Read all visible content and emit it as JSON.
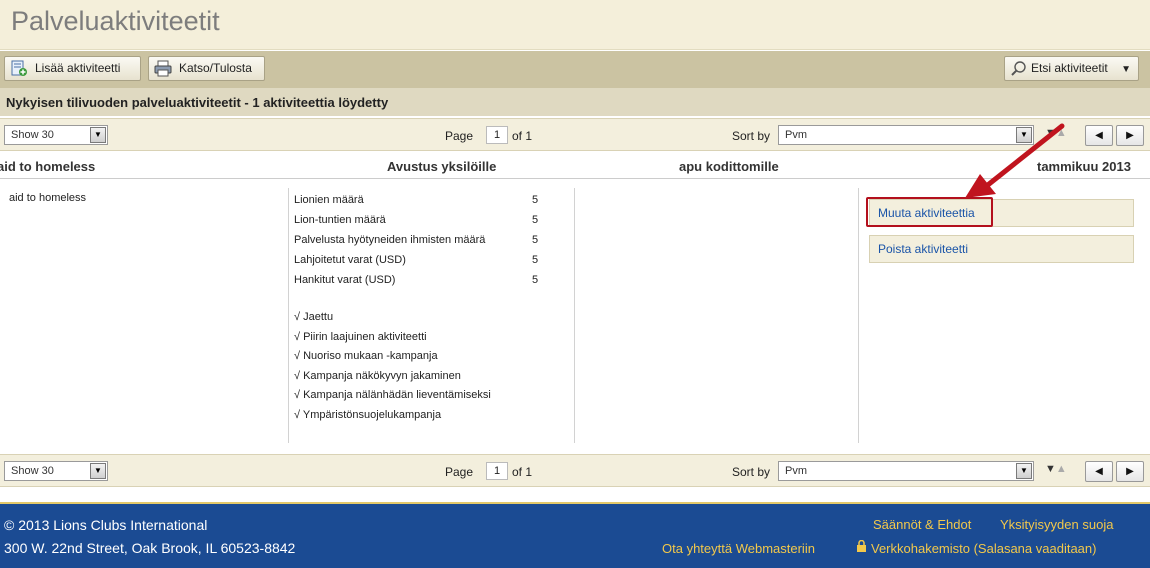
{
  "page": {
    "title": "Palveluaktiviteetit"
  },
  "toolbar": {
    "add_label": "Lisää aktiviteetti",
    "print_label": "Katso/Tulosta",
    "search_label": "Etsi aktiviteetit"
  },
  "heading": "Nykyisen tilivuoden palveluaktiviteetit - 1 aktiviteettia löydetty",
  "pager": {
    "show_value": "Show 30",
    "page_label": "Page",
    "page_value": "1",
    "of_label": "of 1",
    "sort_label": "Sort by",
    "sort_value": "Pvm"
  },
  "columns": {
    "name": "aid to homeless",
    "type": "Avustus yksilöille",
    "description": "apu kodittomille",
    "date": "tammikuu 2013"
  },
  "activity": {
    "name": "aid to homeless",
    "metrics": [
      {
        "label": "Lionien määrä",
        "value": "5"
      },
      {
        "label": "Lion-tuntien määrä",
        "value": "5"
      },
      {
        "label": "Palvelusta hyötyneiden ihmisten määrä",
        "value": "5"
      },
      {
        "label": "Lahjoitetut varat (USD)",
        "value": "5"
      },
      {
        "label": "Hankitut varat (USD)",
        "value": "5"
      }
    ],
    "checks": [
      "√  Jaettu",
      "√  Piirin laajuinen aktiviteetti",
      "√  Nuoriso mukaan -kampanja",
      "√  Kampanja näkökyvyn jakaminen",
      "√  Kampanja nälänhädän lieventämiseksi",
      "√  Ympäristönsuojelukampanja"
    ],
    "edit_label": "Muuta aktiviteettia",
    "delete_label": "Poista aktiviteetti"
  },
  "footer": {
    "copyright": "© 2013 Lions Clubs International",
    "address": "300 W. 22nd Street, Oak Brook, IL 60523-8842",
    "terms": "Säännöt & Ehdot",
    "privacy": "Yksityisyyden suoja",
    "contact": "Ota yhteyttä Webmasteriin",
    "directory": "Verkkohakemisto (Salasana vaaditaan)"
  },
  "colors": {
    "footer_bg": "#1b4b93",
    "footer_link": "#f2c84b",
    "link": "#1a54a8",
    "highlight": "#b3101d"
  }
}
